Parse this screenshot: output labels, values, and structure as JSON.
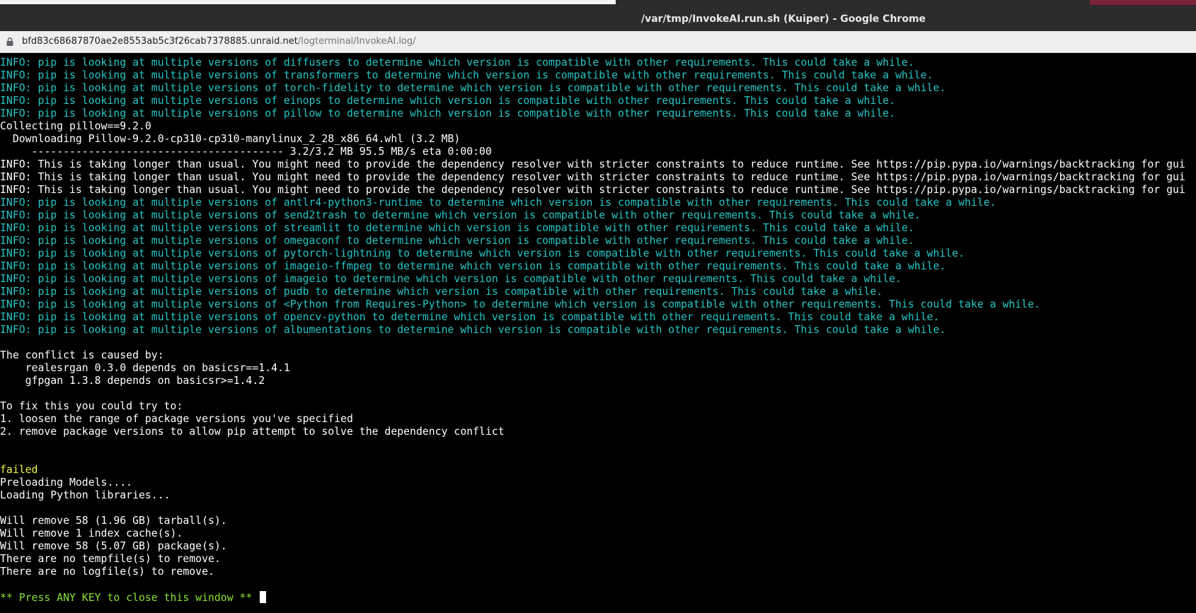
{
  "window": {
    "title": "/var/tmp/InvokeAI.run.sh (Kuiper) - Google Chrome"
  },
  "address_bar": {
    "icon": "lock-icon",
    "host": "bfd83c68687870ae2e8553ab5c3f26cab7378885.unraid.net",
    "path": "/logterminal/InvokeAI.log/"
  },
  "colors": {
    "terminal_bg": "#000000",
    "text": "#ffffff",
    "info": "#26c6c6",
    "failed": "#f2f24a",
    "prompt": "#8ae234"
  },
  "terminal": {
    "lines": [
      {
        "color": "cyan",
        "text": "INFO: pip is looking at multiple versions of diffusers to determine which version is compatible with other requirements. This could take a while."
      },
      {
        "color": "cyan",
        "text": "INFO: pip is looking at multiple versions of transformers to determine which version is compatible with other requirements. This could take a while."
      },
      {
        "color": "cyan",
        "text": "INFO: pip is looking at multiple versions of torch-fidelity to determine which version is compatible with other requirements. This could take a while."
      },
      {
        "color": "cyan",
        "text": "INFO: pip is looking at multiple versions of einops to determine which version is compatible with other requirements. This could take a while."
      },
      {
        "color": "cyan",
        "text": "INFO: pip is looking at multiple versions of pillow to determine which version is compatible with other requirements. This could take a while."
      },
      {
        "color": "white",
        "text": "Collecting pillow==9.2.0"
      },
      {
        "color": "white",
        "text": "  Downloading Pillow-9.2.0-cp310-cp310-manylinux_2_28_x86_64.whl (3.2 MB)"
      },
      {
        "color": "white",
        "text": "     ---------------------------------------- 3.2/3.2 MB 95.5 MB/s eta 0:00:00"
      },
      {
        "color": "white",
        "text": "INFO: This is taking longer than usual. You might need to provide the dependency resolver with stricter constraints to reduce runtime. See https://pip.pypa.io/warnings/backtracking for gui"
      },
      {
        "color": "white",
        "text": "INFO: This is taking longer than usual. You might need to provide the dependency resolver with stricter constraints to reduce runtime. See https://pip.pypa.io/warnings/backtracking for gui"
      },
      {
        "color": "white",
        "text": "INFO: This is taking longer than usual. You might need to provide the dependency resolver with stricter constraints to reduce runtime. See https://pip.pypa.io/warnings/backtracking for gui"
      },
      {
        "color": "cyan",
        "text": "INFO: pip is looking at multiple versions of antlr4-python3-runtime to determine which version is compatible with other requirements. This could take a while."
      },
      {
        "color": "cyan",
        "text": "INFO: pip is looking at multiple versions of send2trash to determine which version is compatible with other requirements. This could take a while."
      },
      {
        "color": "cyan",
        "text": "INFO: pip is looking at multiple versions of streamlit to determine which version is compatible with other requirements. This could take a while."
      },
      {
        "color": "cyan",
        "text": "INFO: pip is looking at multiple versions of omegaconf to determine which version is compatible with other requirements. This could take a while."
      },
      {
        "color": "cyan",
        "text": "INFO: pip is looking at multiple versions of pytorch-lightning to determine which version is compatible with other requirements. This could take a while."
      },
      {
        "color": "cyan",
        "text": "INFO: pip is looking at multiple versions of imageio-ffmpeg to determine which version is compatible with other requirements. This could take a while."
      },
      {
        "color": "cyan",
        "text": "INFO: pip is looking at multiple versions of imageio to determine which version is compatible with other requirements. This could take a while."
      },
      {
        "color": "cyan",
        "text": "INFO: pip is looking at multiple versions of pudb to determine which version is compatible with other requirements. This could take a while."
      },
      {
        "color": "cyan",
        "text": "INFO: pip is looking at multiple versions of <Python from Requires-Python> to determine which version is compatible with other requirements. This could take a while."
      },
      {
        "color": "cyan",
        "text": "INFO: pip is looking at multiple versions of opencv-python to determine which version is compatible with other requirements. This could take a while."
      },
      {
        "color": "cyan",
        "text": "INFO: pip is looking at multiple versions of albumentations to determine which version is compatible with other requirements. This could take a while."
      },
      {
        "color": "white",
        "text": ""
      },
      {
        "color": "white",
        "text": "The conflict is caused by:"
      },
      {
        "color": "white",
        "text": "    realesrgan 0.3.0 depends on basicsr==1.4.1"
      },
      {
        "color": "white",
        "text": "    gfpgan 1.3.8 depends on basicsr>=1.4.2"
      },
      {
        "color": "white",
        "text": ""
      },
      {
        "color": "white",
        "text": "To fix this you could try to:"
      },
      {
        "color": "white",
        "text": "1. loosen the range of package versions you've specified"
      },
      {
        "color": "white",
        "text": "2. remove package versions to allow pip attempt to solve the dependency conflict"
      },
      {
        "color": "white",
        "text": ""
      },
      {
        "color": "white",
        "text": ""
      },
      {
        "color": "yellow",
        "text": "failed"
      },
      {
        "color": "white",
        "text": "Preloading Models...."
      },
      {
        "color": "white",
        "text": "Loading Python libraries..."
      },
      {
        "color": "white",
        "text": ""
      },
      {
        "color": "white",
        "text": "Will remove 58 (1.96 GB) tarball(s)."
      },
      {
        "color": "white",
        "text": "Will remove 1 index cache(s)."
      },
      {
        "color": "white",
        "text": "Will remove 58 (5.07 GB) package(s)."
      },
      {
        "color": "white",
        "text": "There are no tempfile(s) to remove."
      },
      {
        "color": "white",
        "text": "There are no logfile(s) to remove."
      },
      {
        "color": "white",
        "text": ""
      }
    ],
    "prompt": {
      "color": "green",
      "text": "** Press ANY KEY to close this window ** "
    }
  }
}
